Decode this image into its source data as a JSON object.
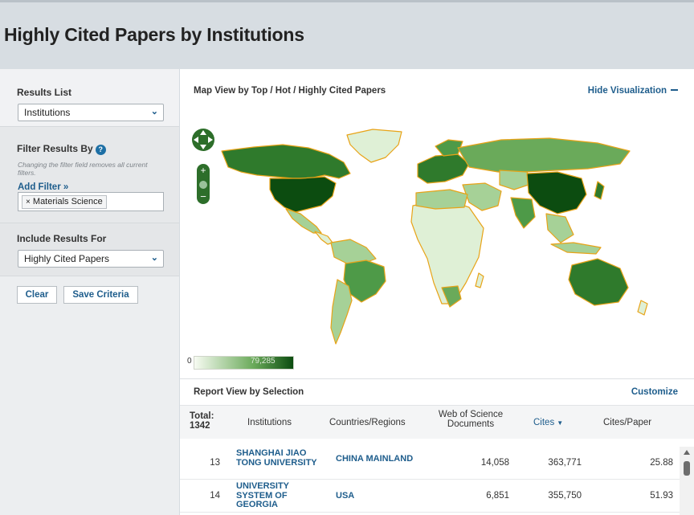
{
  "page": {
    "title": "Highly Cited Papers by Institutions"
  },
  "sidebar": {
    "results_list": {
      "label": "Results List",
      "value": "Institutions"
    },
    "filter": {
      "label": "Filter Results By",
      "note": "Changing the filter field removes all current filters.",
      "add_filter": "Add Filter »",
      "chips": [
        {
          "remove": "×",
          "label": "Materials Science"
        }
      ]
    },
    "include": {
      "label": "Include Results For",
      "value": "Highly Cited Papers"
    },
    "buttons": {
      "clear": "Clear",
      "save": "Save Criteria"
    }
  },
  "visualization": {
    "title": "Map View by Top / Hot / Highly Cited Papers",
    "hide_label": "Hide Visualization",
    "legend": {
      "min": "0",
      "max": "79,285"
    },
    "colors": {
      "border": "#e8a317",
      "dark": "#0c4c10",
      "mid": "#4e9a48",
      "light": "#a6d197",
      "pale": "#dff0d6",
      "none": "#ffffff"
    }
  },
  "report": {
    "title": "Report View by Selection",
    "customize": "Customize",
    "headers": {
      "total": "Total: 1342",
      "institutions": "Institutions",
      "countries": "Countries/Regions",
      "wos": "Web of Science Documents",
      "cites": "Cites",
      "cites_per_paper": "Cites/Paper"
    },
    "rows": [
      {
        "rank": "13",
        "institution": "SHANGHAI JIAO TONG UNIVERSITY",
        "country": "CHINA MAINLAND",
        "documents": "14,058",
        "cites": "363,771",
        "cites_per_paper": "25.88"
      },
      {
        "rank": "14",
        "institution": "UNIVERSITY SYSTEM OF GEORGIA",
        "country": "USA",
        "documents": "6,851",
        "cites": "355,750",
        "cites_per_paper": "51.93"
      }
    ]
  }
}
